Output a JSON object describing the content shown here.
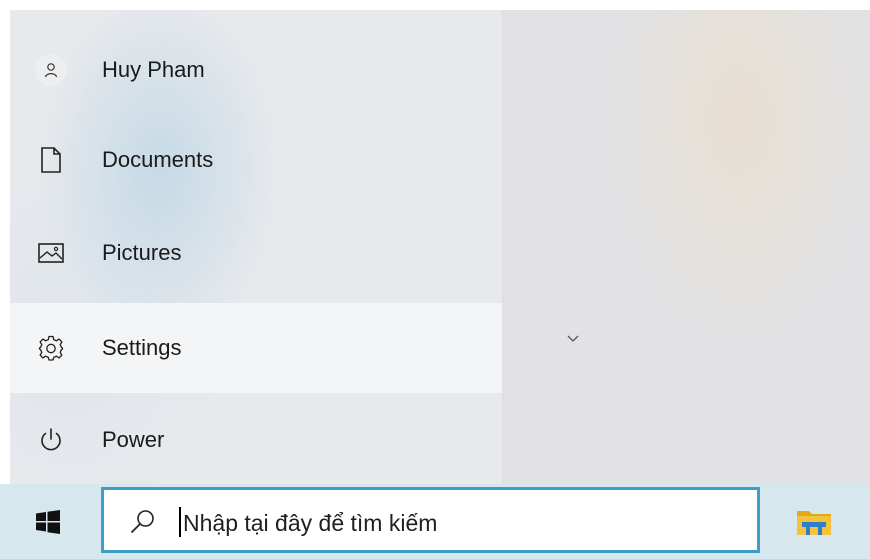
{
  "start_menu": {
    "items": [
      {
        "label": "Huy Pham",
        "icon": "user-avatar-icon"
      },
      {
        "label": "Documents",
        "icon": "document-icon"
      },
      {
        "label": "Pictures",
        "icon": "pictures-icon"
      },
      {
        "label": "Settings",
        "icon": "gear-icon",
        "highlighted": true
      },
      {
        "label": "Power",
        "icon": "power-icon"
      }
    ]
  },
  "expand_chevron": {
    "icon": "chevron-down-icon"
  },
  "taskbar": {
    "start_button": {
      "icon": "windows-logo-icon"
    },
    "search": {
      "text": "Nhập tại đây để tìm kiếm",
      "icon": "search-icon"
    },
    "pinned": [
      {
        "icon": "file-explorer-icon"
      }
    ]
  },
  "colors": {
    "search_border": "#3aa0c6",
    "taskbar": "#d7e7ee",
    "menu_highlight": "#f4f5f6"
  }
}
